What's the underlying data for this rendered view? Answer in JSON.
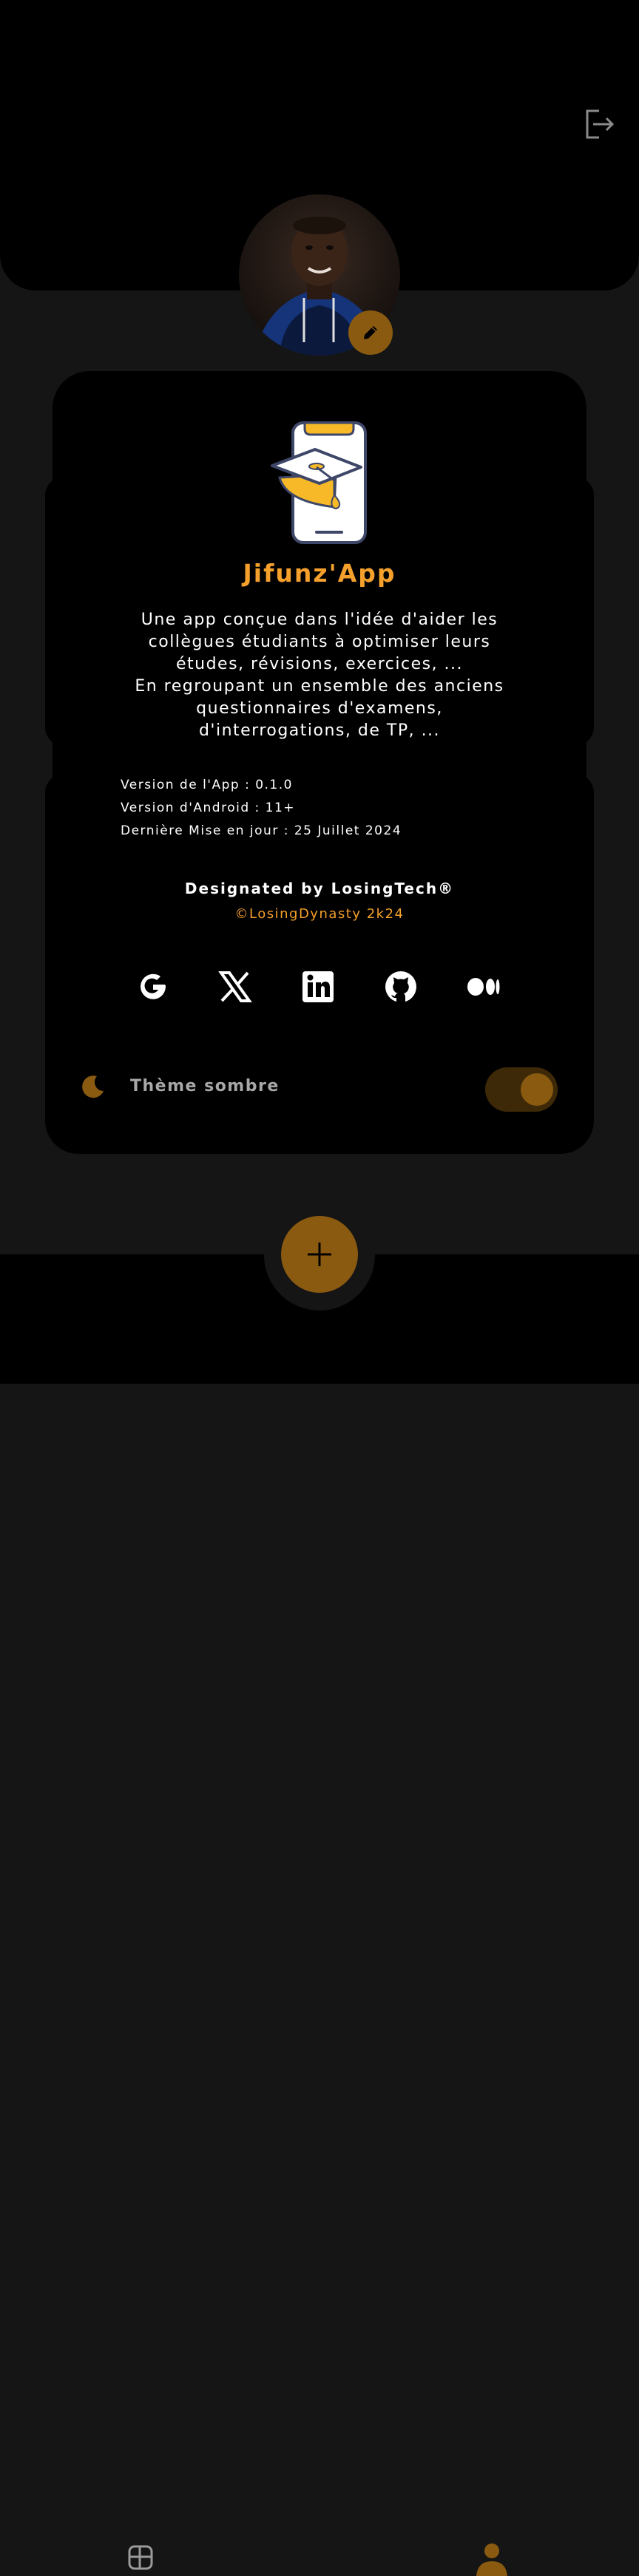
{
  "header": {
    "logout_icon": "logout-icon"
  },
  "profile": {
    "edit_icon": "pencil-icon"
  },
  "app": {
    "name": "Jifunz'App",
    "description_lines": [
      "Une app conçue dans l'idée d'aider les",
      "collègues étudiants à optimiser leurs",
      "études, révisions, exercices, ...",
      "En regroupant un ensemble des anciens",
      "questionnaires d'examens,",
      "d'interrogations, de TP, ..."
    ],
    "info": {
      "app_version": "Version de l'App : 0.1.0",
      "android_version": "Version d'Android : 11+",
      "last_update": "Dernière Mise en jour : 25 Juillet 2024"
    },
    "credit": "Designated by LosingTech®",
    "copyright": "©LosingDynasty 2k24"
  },
  "social": [
    "google-icon",
    "x-icon",
    "linkedin-icon",
    "github-icon",
    "medium-icon"
  ],
  "theme": {
    "label": "Thème sombre",
    "dark_mode_enabled": true
  },
  "colors": {
    "accent": "#f5a02c",
    "accent_dark": "#8a5a10",
    "background": "#151515",
    "surface": "#000000"
  },
  "nav": {
    "left_icon": "dashboard-icon",
    "fab_icon": "plus-icon",
    "right_icon": "profile-icon"
  }
}
